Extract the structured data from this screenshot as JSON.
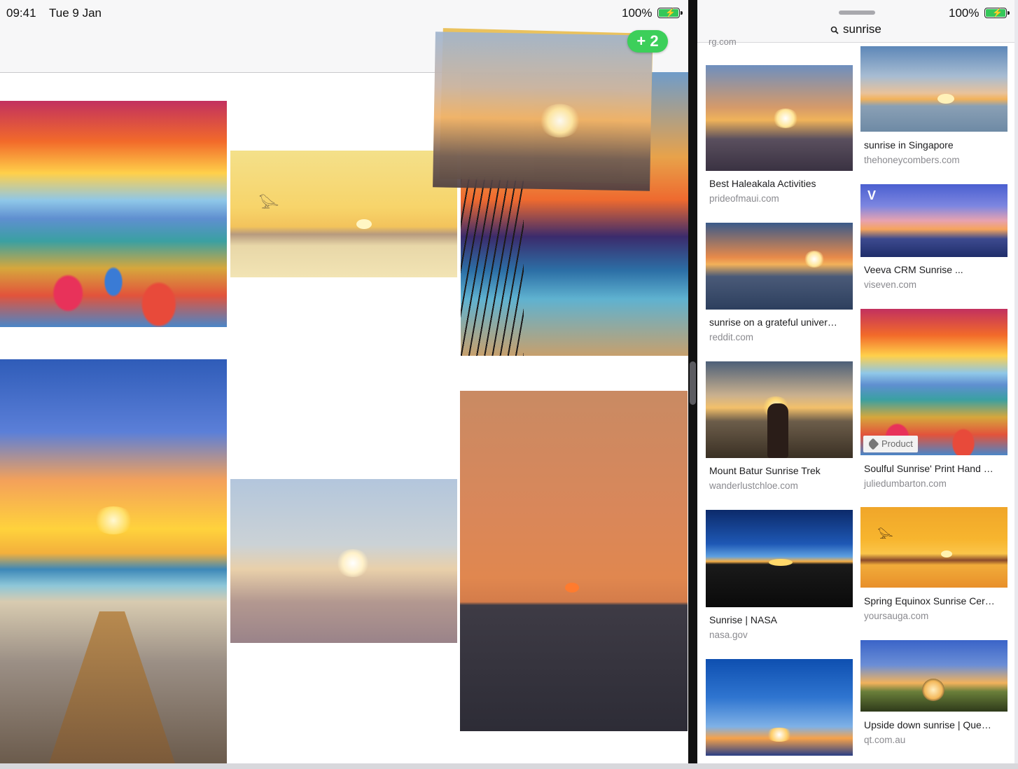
{
  "status_bar": {
    "time": "09:41",
    "date": "Tue 9 Jan",
    "battery_left": "100%",
    "battery_right": "100%"
  },
  "drag": {
    "badge": "+ 2"
  },
  "search": {
    "query": "sunrise",
    "cut_source": "rg.com"
  },
  "results": [
    {
      "title": "Best Haleakala Activities",
      "source": "prideofmaui.com"
    },
    {
      "title": "sunrise in Singapore",
      "source": "thehoneycombers.com"
    },
    {
      "title": "sunrise on a grateful univer…",
      "source": "reddit.com"
    },
    {
      "title": "Veeva CRM Sunrise ...",
      "source": "viseven.com"
    },
    {
      "title": "Soulful Sunrise' Print Hand …",
      "source": "juliedumbarton.com",
      "tag": "Product"
    },
    {
      "title": "Mount Batur Sunrise Trek",
      "source": "wanderlustchloe.com"
    },
    {
      "title": "Spring Equinox Sunrise Cer…",
      "source": "yoursauga.com"
    },
    {
      "title": "Sunrise | NASA",
      "source": "nasa.gov"
    },
    {
      "title": "Upside down sunrise | Que…",
      "source": "qt.com.au"
    }
  ],
  "colors": {
    "accent_green": "#3ccf5a",
    "battery_green": "#34c759",
    "source_gray": "#8a8a8f"
  }
}
